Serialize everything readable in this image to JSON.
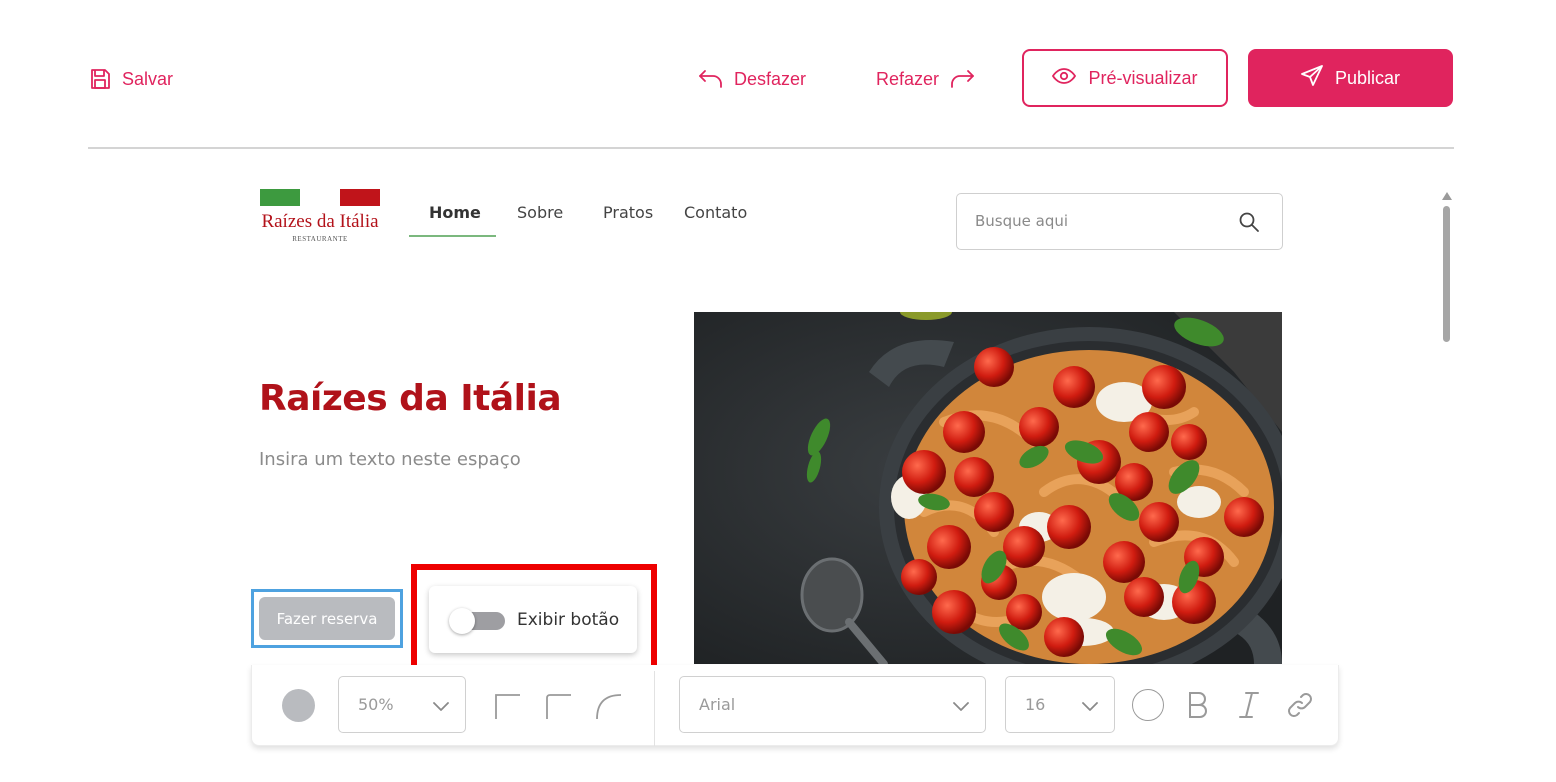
{
  "toolbar": {
    "save_label": "Salvar",
    "undo_label": "Desfazer",
    "redo_label": "Refazer",
    "preview_label": "Pré-visualizar",
    "publish_label": "Publicar"
  },
  "site": {
    "logo": {
      "name": "Raízes da Itália",
      "subtitle": "RESTAURANTE"
    },
    "nav": [
      {
        "label": "Home",
        "active": true
      },
      {
        "label": "Sobre",
        "active": false
      },
      {
        "label": "Pratos",
        "active": false
      },
      {
        "label": "Contato",
        "active": false
      }
    ],
    "search": {
      "placeholder": "Busque aqui"
    },
    "hero": {
      "title": "Raízes da Itália",
      "text": "Insira um texto neste espaço",
      "button_label": "Fazer reserva",
      "image_icon": "pasta-skillet-image"
    },
    "toggle": {
      "label": "Exibir botão",
      "on": false
    }
  },
  "format_toolbar": {
    "opacity": "50%",
    "font": "Arial",
    "font_size": "16",
    "button_color": "#b9bbbf"
  },
  "colors": {
    "accent": "#e0245e",
    "brand_red": "#b0121a",
    "brand_green": "#3d9a3f",
    "selection_blue": "#4ea2e0",
    "highlight_red": "#ee0000"
  }
}
